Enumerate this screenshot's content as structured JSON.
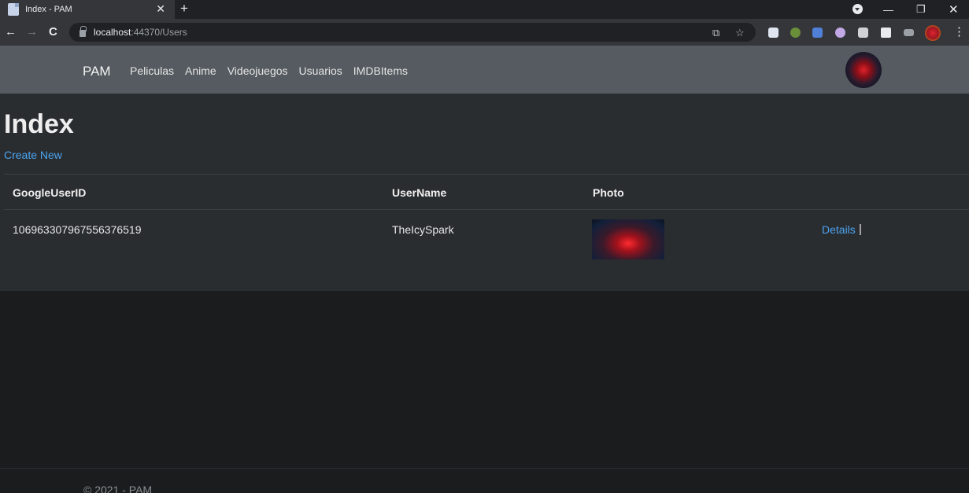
{
  "browser": {
    "tab_title": "Index - PAM",
    "url_host": "localhost",
    "url_rest": ":44370/Users"
  },
  "navbar": {
    "brand": "PAM",
    "links": [
      "Peliculas",
      "Anime",
      "Videojuegos",
      "Usuarios",
      "IMDBItems"
    ]
  },
  "page": {
    "title": "Index",
    "create_link": "Create New"
  },
  "table": {
    "headers": [
      "GoogleUserID",
      "UserName",
      "Photo"
    ],
    "rows": [
      {
        "google_user_id": "106963307967556376519",
        "user_name": "TheIcySpark",
        "details": "Details",
        "separator": "|"
      }
    ]
  },
  "footer": {
    "text": "© 2021 - PAM"
  }
}
